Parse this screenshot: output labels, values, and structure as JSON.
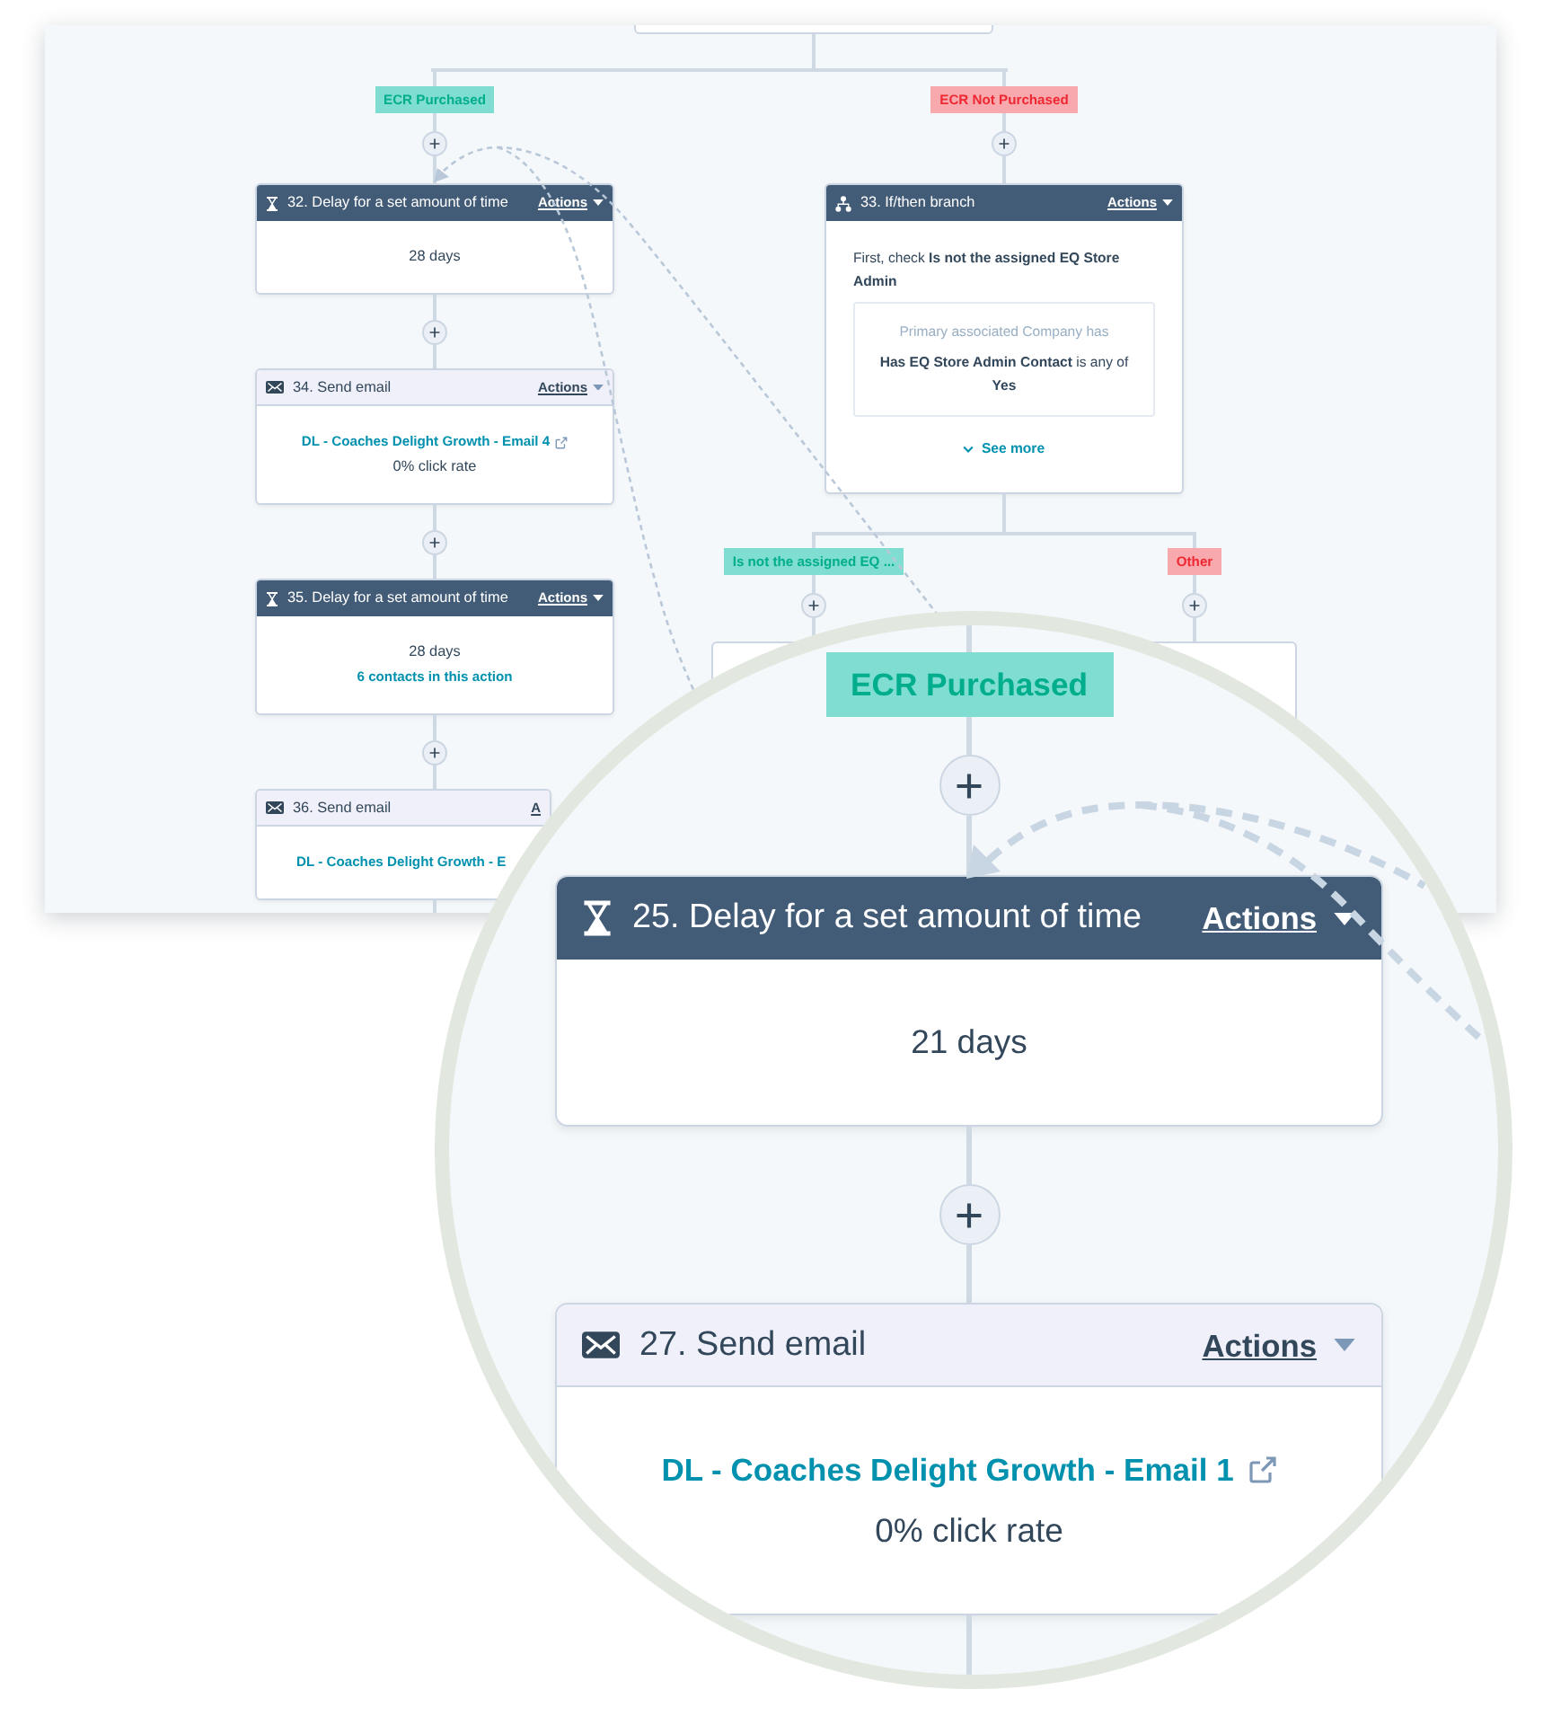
{
  "workflow": {
    "branches": [
      {
        "label": "ECR Purchased",
        "color": "#7fded1",
        "steps": [
          {
            "kind": "delay",
            "title": "32. Delay for a set amount of time",
            "actions": "Actions",
            "duration": "28 days",
            "covered": false
          },
          {
            "kind": "email",
            "title": "34. Send email",
            "actions": "Actions",
            "email": "DL - Coaches Delight Growth - Email 4",
            "stat": "0% click rate",
            "covered": false
          },
          {
            "kind": "delay",
            "title": "35. Delay for a set amount of time",
            "actions": "Actions",
            "duration": "28 days",
            "contacts": "6 contacts in this action",
            "covered": false
          },
          {
            "kind": "email",
            "title": "36. Send email",
            "actions": "A",
            "email": "DL - Coaches Delight Growth - E",
            "covered": true
          }
        ]
      },
      {
        "label": "ECR Not Purchased",
        "color": "#f8a9ad",
        "steps": [
          {
            "kind": "branch",
            "title": "33. If/then branch",
            "actions": "Actions",
            "condition": "First, check **Is not the assigned EQ Store Admin**",
            "filter_heading": "Primary associated Company has",
            "filter_rule": "**Has EQ Store Admin Contact** is any of",
            "filter_value": "Yes",
            "see_more": "See more",
            "covered": false,
            "branches": [
              {
                "label": "Is not the assigned EQ ...",
                "color": "#7fded1"
              },
              {
                "label": "Other",
                "color": "#f8a9ad"
              }
            ]
          }
        ]
      }
    ]
  },
  "magnifier": {
    "label": "ECR Purchased",
    "color": "#7fded1",
    "steps": [
      {
        "kind": "delay",
        "title": "25. Delay for a set amount of time",
        "actions": "Actions",
        "duration": "21 days",
        "covered": false
      },
      {
        "kind": "email",
        "title": "27. Send email",
        "actions": "Actions",
        "email": "DL - Coaches Delight Growth - Email 1",
        "stat": "0% click rate",
        "covered": false
      }
    ]
  }
}
